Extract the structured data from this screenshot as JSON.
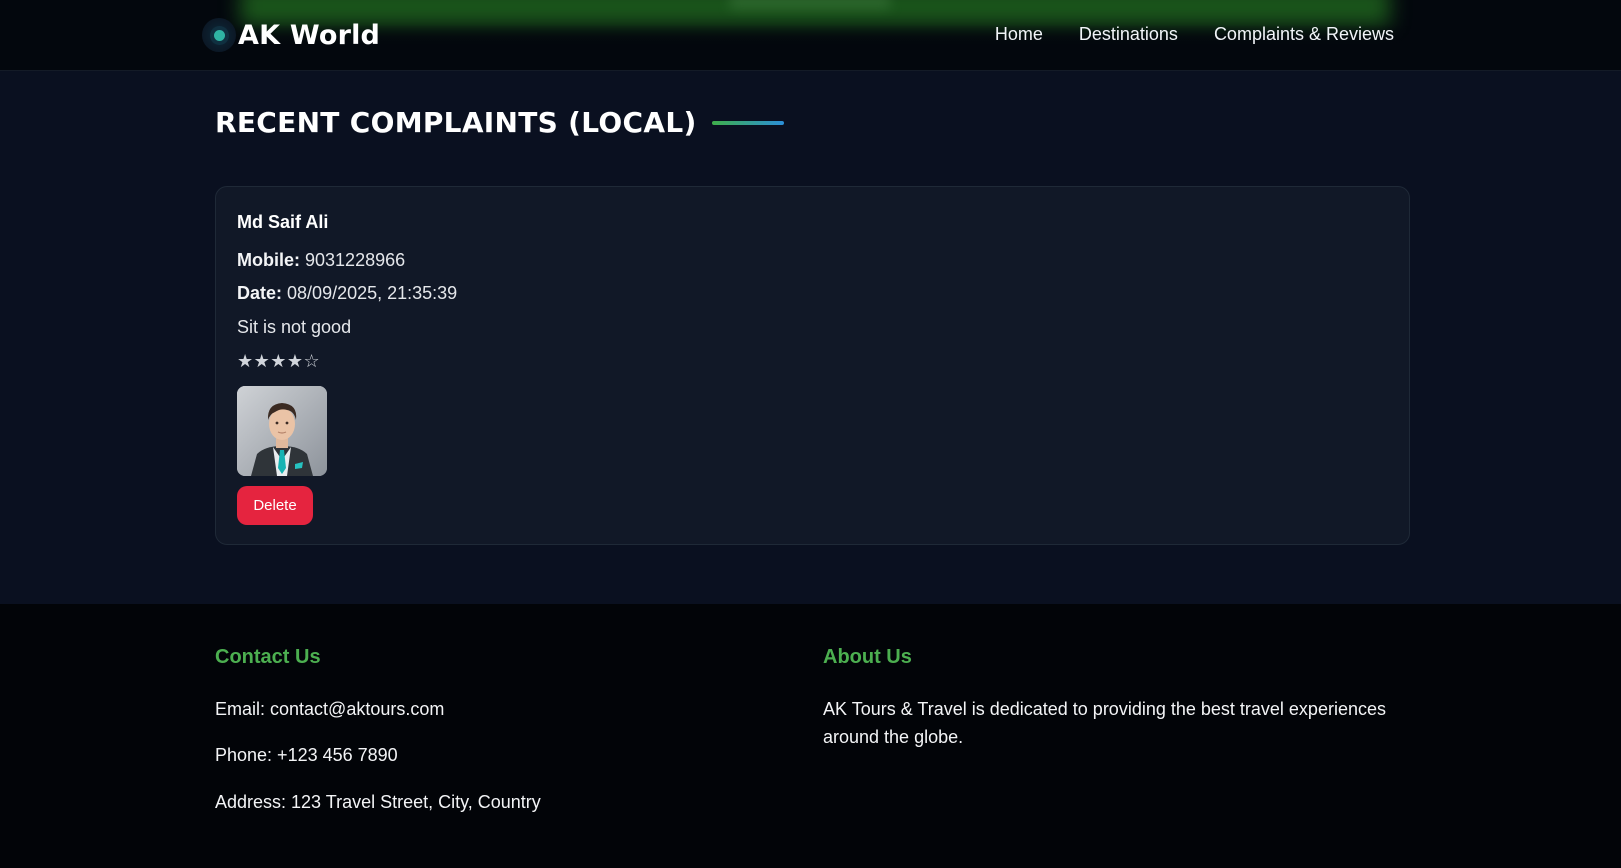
{
  "header": {
    "logo_text": "AK World",
    "nav": [
      {
        "label": "Home"
      },
      {
        "label": "Destinations"
      },
      {
        "label": "Complaints & Reviews"
      }
    ]
  },
  "main": {
    "title": "RECENT COMPLAINTS (LOCAL)",
    "complaint": {
      "name": "Md Saif Ali",
      "mobile_label": "Mobile:",
      "mobile": "9031228966",
      "date_label": "Date:",
      "date": "08/09/2025, 21:35:39",
      "message": "Sit is not good",
      "stars_display": "★★★★☆",
      "rating": 4,
      "rating_max": 5,
      "delete_label": "Delete"
    }
  },
  "footer": {
    "contact_title": "Contact Us",
    "email": "Email: contact@aktours.com",
    "phone": "Phone: +123 456 7890",
    "address": "Address: 123 Travel Street, City, Country",
    "about_title": "About Us",
    "about_text": "AK Tours & Travel is dedicated to providing the best travel experiences around the globe."
  },
  "colors": {
    "page_bg": "#0a1020",
    "card_bg": "#111827",
    "accent_green": "#4caf50",
    "delete_red": "#e5243f"
  }
}
